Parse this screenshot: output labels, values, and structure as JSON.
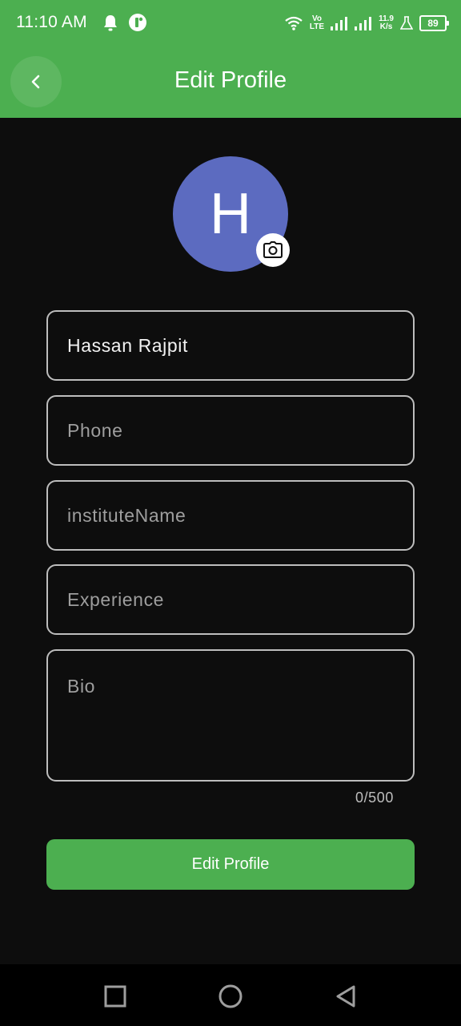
{
  "status_bar": {
    "time": "11:10 AM",
    "network_top": "Vo",
    "network_bottom": "LTE",
    "speed_value": "11.9",
    "speed_unit": "K/s",
    "battery": "89"
  },
  "app_bar": {
    "title": "Edit Profile",
    "back_icon": "chevron-left-icon"
  },
  "avatar": {
    "initial": "H",
    "bg_color": "#5c6bc0",
    "camera_icon": "camera-icon"
  },
  "form": {
    "name_value": "Hassan Rajpit",
    "phone_placeholder": "Phone",
    "institute_placeholder": "instituteName",
    "experience_placeholder": "Experience",
    "bio_placeholder": "Bio",
    "bio_counter": "0/500"
  },
  "submit": {
    "label": "Edit Profile"
  },
  "colors": {
    "accent": "#4caf50",
    "background": "#0d0d0d",
    "field_border": "#bdbdbd"
  },
  "nav": {
    "recent_icon": "square-icon",
    "home_icon": "circle-icon",
    "back_icon": "triangle-back-icon"
  }
}
